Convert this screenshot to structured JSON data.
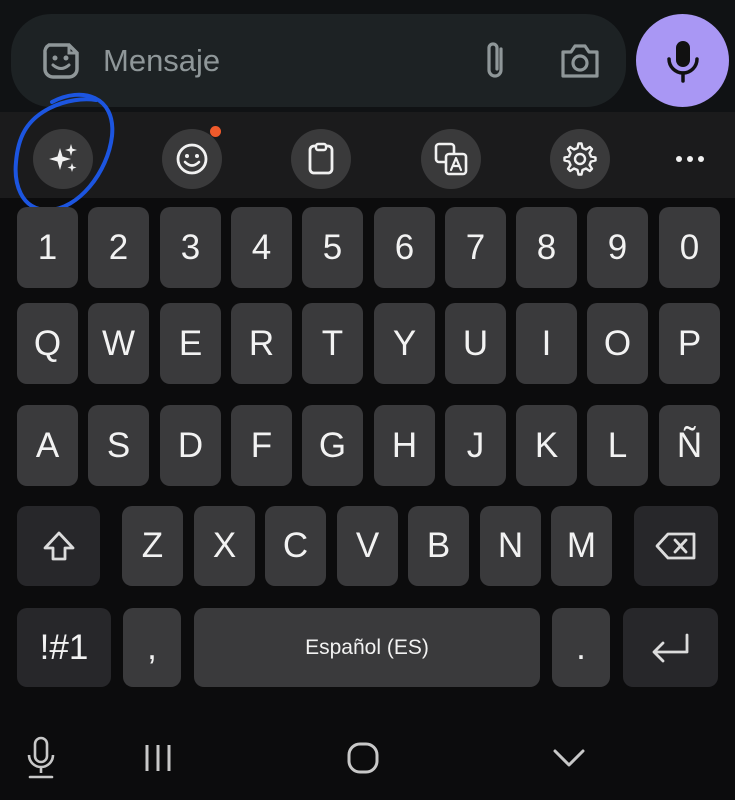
{
  "message_bar": {
    "placeholder": "Mensaje",
    "icons": [
      "sticker-icon",
      "paperclip-icon",
      "camera-icon"
    ]
  },
  "mic_button": {
    "icon": "microphone-icon",
    "color": "#a997f4"
  },
  "toolbar": {
    "items": [
      {
        "icon": "sparkles-icon",
        "highlighted": true
      },
      {
        "icon": "emoji-icon",
        "notification_dot": true
      },
      {
        "icon": "clipboard-icon"
      },
      {
        "icon": "translate-icon"
      },
      {
        "icon": "gear-icon"
      },
      {
        "icon": "more-icon"
      }
    ],
    "annotation_color": "#1c55e0",
    "notification_color": "#f05a2b"
  },
  "keyboard": {
    "number_row": [
      "1",
      "2",
      "3",
      "4",
      "5",
      "6",
      "7",
      "8",
      "9",
      "0"
    ],
    "row1": [
      "Q",
      "W",
      "E",
      "R",
      "T",
      "Y",
      "U",
      "I",
      "O",
      "P"
    ],
    "row2": [
      "A",
      "S",
      "D",
      "F",
      "G",
      "H",
      "J",
      "K",
      "L",
      "Ñ"
    ],
    "row3": [
      "Z",
      "X",
      "C",
      "V",
      "B",
      "N",
      "M"
    ],
    "symbols_label": "!#1",
    "comma_label": ",",
    "space_label": "Español (ES)",
    "period_label": ".",
    "shift_icon": "shift-icon",
    "backspace_icon": "backspace-icon",
    "enter_icon": "enter-icon"
  },
  "nav_bar": {
    "icons": [
      "voice-input-icon",
      "recent-apps-icon",
      "home-icon",
      "hide-keyboard-icon"
    ]
  }
}
